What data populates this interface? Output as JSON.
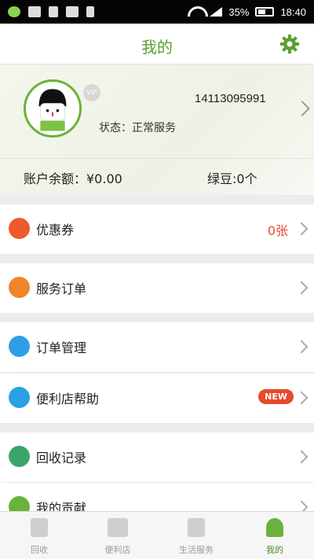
{
  "status_bar": {
    "battery": "35%",
    "time": "18:40"
  },
  "header": {
    "title": "我的"
  },
  "profile": {
    "phone": "14113095991",
    "status": "状态：正常服务",
    "vip": "VIP",
    "balance": "账户余额：¥0.00",
    "beans": "绿豆:0个"
  },
  "menu": {
    "coupon": {
      "label": "优惠券",
      "count": "0张"
    },
    "service_orders": {
      "label": "服务订单"
    },
    "order_manage": {
      "label": "订单管理"
    },
    "store_help": {
      "label": "便利店帮助",
      "badge": "NEW"
    },
    "recycle": {
      "label": "回收记录"
    },
    "contrib": {
      "label": "我的贡献"
    }
  },
  "tabs": [
    {
      "label": "回收"
    },
    {
      "label": "便利店"
    },
    {
      "label": "生活服务"
    },
    {
      "label": "我的"
    }
  ],
  "colors": {
    "accent": "#5aa12c",
    "orange": "#f0842a",
    "blue": "#2f9ee6",
    "green": "#3aa569",
    "red": "#e44e2a"
  }
}
